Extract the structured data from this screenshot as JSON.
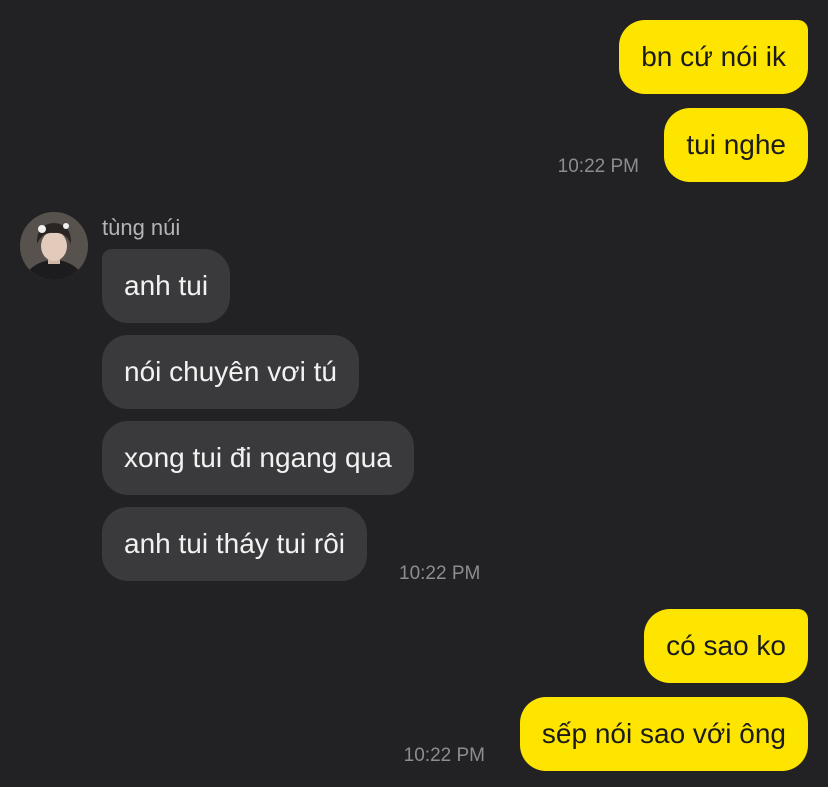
{
  "chat": {
    "group1": {
      "messages": [
        "bn cứ nói ik",
        "tui nghe"
      ],
      "timestamp": "10:22 PM"
    },
    "group2": {
      "sender": {
        "name": "tùng núi",
        "avatar_icon": "profile-photo-avatar"
      },
      "messages": [
        "anh tui",
        "nói chuyên vơi tú",
        "xong tui đi ngang qua",
        "anh tui tháy tui rôi"
      ],
      "timestamp": "10:22 PM"
    },
    "group3": {
      "messages": [
        "có sao ko",
        "sếp nói sao với ông"
      ],
      "timestamp": "10:22 PM"
    }
  },
  "colors": {
    "background": "#222224",
    "outgoing_bubble": "#fee500",
    "incoming_bubble": "#3a3a3c",
    "outgoing_text": "#1b1b1b",
    "incoming_text": "#f2f2f2",
    "timestamp": "#8d8d8f"
  }
}
